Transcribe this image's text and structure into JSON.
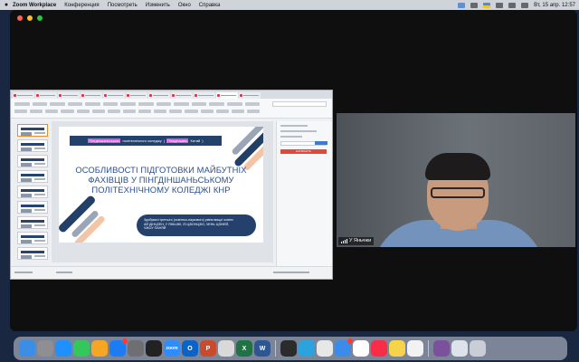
{
  "menubar": {
    "apple": "",
    "app_name": "Zoom Workplace",
    "items": [
      "Конференция",
      "Посмотреть",
      "Изменить",
      "Окно",
      "Справка"
    ],
    "clock": "Вт, 15 апр.  12:57"
  },
  "slide": {
    "header_highlight_1": "Пінгдіншаньського",
    "header_text": "політехнічного коледжу",
    "header_highlight_2": "Пінгдіншань",
    "header_suffix": "Китай",
    "title": "ОСОБЛИВОСТІ ПІДГОТОВКИ МАЙБУТНІХ ФАХІВЦІВ У ПІНГДІНШАНЬСЬКОМУ ПОЛІТЕХНІЧНОМУ КОЛЕДЖІ КНР",
    "authors_line1": "Здобувачі третього (освітньо-наукового) рівня вищої освіти:",
    "authors_line2": "АЙ ДІНЦЗЕН, У ЯНЬЧЖІ, ЛІ ЦЗЮНЦЗЮ, ЧЕНЬ ЦЗІНЕЙ,",
    "authors_line3": "ЧЖОУ ПАНЯЙ"
  },
  "wps": {
    "red_button": "НАТИСНІТЬ"
  },
  "video": {
    "participant_name": "У Яньчжи"
  },
  "dock": {
    "apps": [
      {
        "name": "finder",
        "label": "",
        "color": "#3a8ee6"
      },
      {
        "name": "launchpad",
        "label": "",
        "color": "#8e8e93"
      },
      {
        "name": "safari",
        "label": "",
        "color": "#1e90ff"
      },
      {
        "name": "facetime",
        "label": "",
        "color": "#34c759"
      },
      {
        "name": "photos",
        "label": "",
        "color": "#f5a623"
      },
      {
        "name": "app-store",
        "label": "",
        "color": "#1c7cf4"
      },
      {
        "name": "settings",
        "label": "",
        "color": "#6e6e73"
      },
      {
        "name": "chatgpt",
        "label": "",
        "color": "#222222"
      },
      {
        "name": "zoom",
        "label": "zoom",
        "color": "#2d8cff"
      },
      {
        "name": "outlook",
        "label": "O",
        "color": "#0a64c8"
      },
      {
        "name": "powerpoint",
        "label": "P",
        "color": "#c94b2b"
      },
      {
        "name": "word-pad",
        "label": "",
        "color": "#d9d9d9"
      },
      {
        "name": "excel",
        "label": "X",
        "color": "#1f7244"
      },
      {
        "name": "word",
        "label": "W",
        "color": "#2b5797"
      },
      {
        "name": "terminal",
        "label": "",
        "color": "#2b2b2b"
      },
      {
        "name": "telegram",
        "label": "",
        "color": "#2aa3df"
      },
      {
        "name": "chrome",
        "label": "",
        "color": "#e7e7e7"
      },
      {
        "name": "mail",
        "label": "",
        "color": "#3b8bea"
      },
      {
        "name": "calendar",
        "label": "",
        "color": "#ffffff"
      },
      {
        "name": "music",
        "label": "",
        "color": "#fa2d48"
      },
      {
        "name": "notes",
        "label": "",
        "color": "#f7d34a"
      },
      {
        "name": "reminders",
        "label": "",
        "color": "#f2f2f2"
      },
      {
        "name": "viber",
        "label": "",
        "color": "#7b519d"
      },
      {
        "name": "preview",
        "label": "",
        "color": "#dde3ea"
      }
    ]
  },
  "colors": {
    "slide_navy": "#22416b",
    "title_blue": "#2a4f8f",
    "highlight_magenta": "#d25bd6",
    "peach": "#f3c4a6"
  }
}
